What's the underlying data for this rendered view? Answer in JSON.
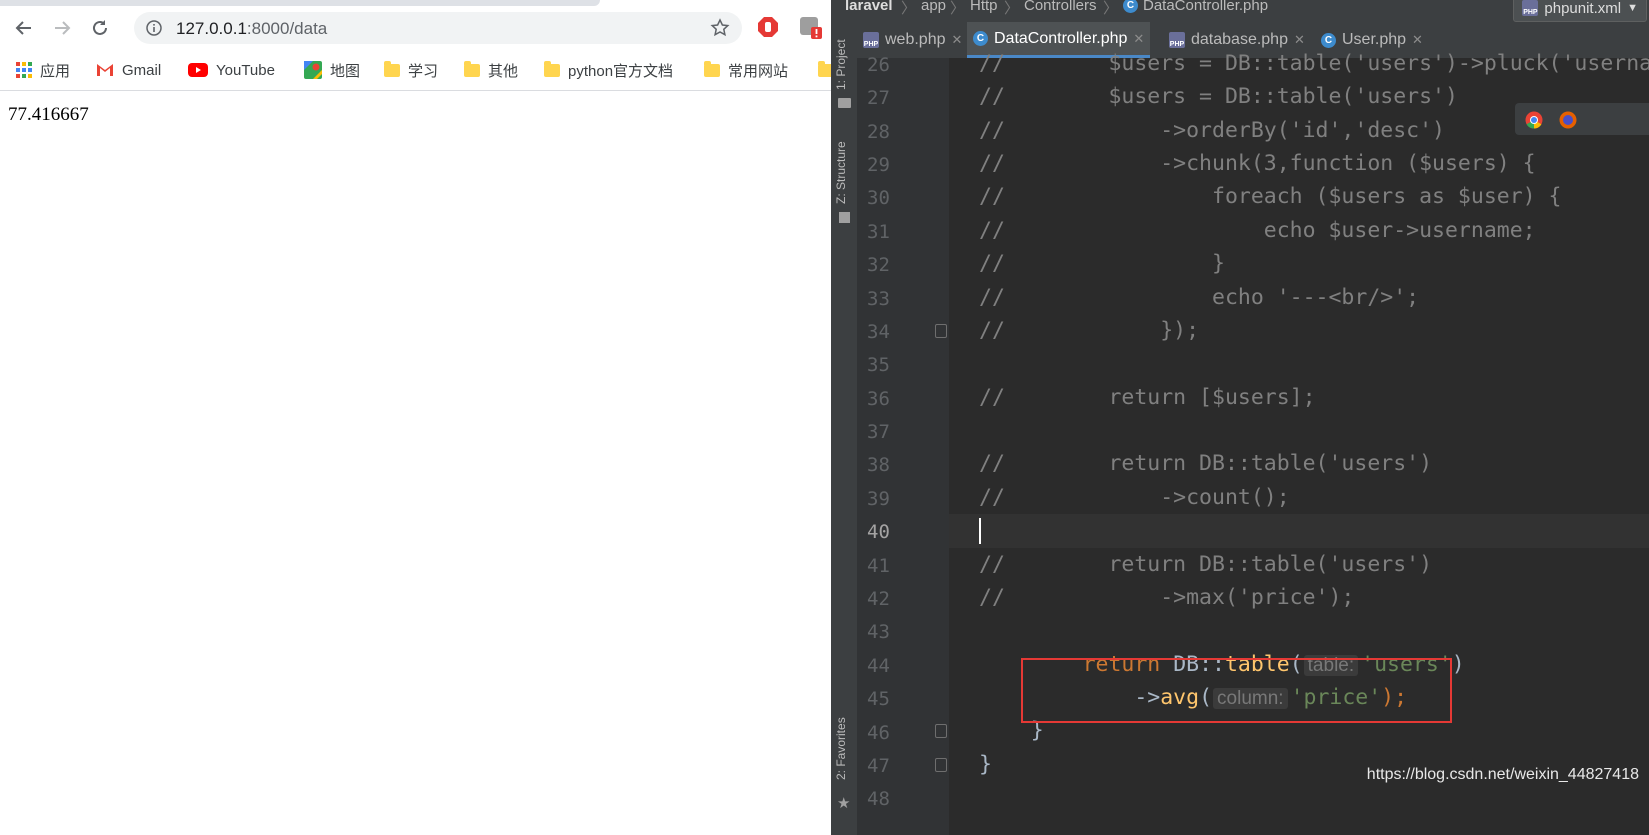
{
  "browser": {
    "url_host": "127.0.0.1",
    "url_rest": ":8000/data",
    "bookmarks": [
      "应用",
      "Gmail",
      "YouTube",
      "地图",
      "学习",
      "其他",
      "python官方文档",
      "常用网站"
    ],
    "page_output": "77.416667"
  },
  "ide": {
    "breadcrumbs": [
      "laravel",
      "app",
      "Http",
      "Controllers",
      "DataController.php"
    ],
    "run_config": "phpunit.xml",
    "side_labels": [
      "1: Project",
      "Z: Structure",
      "2: Favorites"
    ],
    "tabs": [
      {
        "label": "web.php",
        "type": "php"
      },
      {
        "label": "DataController.php",
        "type": "class",
        "active": true
      },
      {
        "label": "database.php",
        "type": "php"
      },
      {
        "label": "User.php",
        "type": "class"
      }
    ],
    "line_numbers": [
      "26",
      "27",
      "28",
      "29",
      "30",
      "31",
      "32",
      "33",
      "34",
      "35",
      "36",
      "37",
      "38",
      "39",
      "40",
      "41",
      "42",
      "43",
      "44",
      "45",
      "46",
      "47",
      "48"
    ],
    "current_line": "40",
    "comment_lines": {
      "l26": "//        $users = DB::table('users')->pluck('username');",
      "l27": "//        $users = DB::table('users')",
      "l28": "//            ->orderBy('id','desc')",
      "l29": "//            ->chunk(3,function ($users) {",
      "l30": "//                foreach ($users as $user) {",
      "l31": "//                    echo $user->username;",
      "l32": "//                }",
      "l33": "//                echo '---<br/>';",
      "l34": "//            });",
      "l36": "//        return [$users];",
      "l38": "//        return DB::table('users')",
      "l39": "//            ->count();",
      "l41": "//        return DB::table('users')",
      "l42": "//            ->max('price');"
    },
    "code44": {
      "kw": "return",
      "cls": "DB",
      "op": "::",
      "fn": "table",
      "open": "(",
      "hint": "table:",
      "str": "'users'",
      "close": ")"
    },
    "code45": {
      "arrow": "->",
      "fn": "avg",
      "open": "(",
      "hint": "column:",
      "str": "'price'",
      "close": ");"
    },
    "line46": "}",
    "line47": "}"
  },
  "watermark": "https://blog.csdn.net/weixin_44827418",
  "colors": {
    "highlight_box": "#e53935",
    "editor_bg": "#2b2b2b"
  }
}
